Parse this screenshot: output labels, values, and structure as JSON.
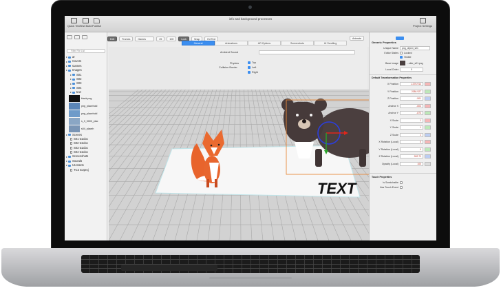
{
  "window": {
    "title": "info and background processes",
    "toolbar_left": [
      "Quick Test",
      "Test Build",
      "Publish"
    ],
    "toolbar_right": "Project Settings"
  },
  "subtoolbar": {
    "items": [
      "Edit",
      "Frames",
      "Games",
      "25",
      "100",
      "Lock",
      "Snap",
      "Ed Text"
    ],
    "right_label": "Animate"
  },
  "tabs": [
    {
      "label": "General",
      "active": true
    },
    {
      "label": "Animations",
      "active": false
    },
    {
      "label": "AR Options",
      "active": false
    },
    {
      "label": "Screenshots",
      "active": false
    },
    {
      "label": "UI Scrolling",
      "active": false
    }
  ],
  "sidebar": {
    "search_placeholder": "Filter File List",
    "tree": [
      {
        "label": "ar",
        "kind": "folder"
      },
      {
        "label": "Covers",
        "kind": "folder"
      },
      {
        "label": "Games",
        "kind": "folder"
      },
      {
        "label": "Images",
        "kind": "folder"
      },
      {
        "label": "S01",
        "kind": "folder"
      },
      {
        "label": "S02",
        "kind": "folder"
      },
      {
        "label": "S03",
        "kind": "folder"
      },
      {
        "label": "S04",
        "kind": "folder"
      },
      {
        "label": "text",
        "kind": "folder"
      }
    ],
    "thumbnails": [
      {
        "label": "black.png",
        "color": "#111111"
      },
      {
        "label": "png_placehold",
        "color": "#5b86b8"
      },
      {
        "label": "png_placehold",
        "color": "#6f9bc9"
      },
      {
        "label": "s_3_0000_plac",
        "color": "#8aa6c4"
      },
      {
        "label": "s04_placeh",
        "color": "#7a95b5"
      }
    ],
    "tree2": [
      {
        "label": "Scenes",
        "kind": "folder"
      },
      {
        "label": "S01 tc2doc",
        "kind": "doc"
      },
      {
        "label": "S02 tc2doc",
        "kind": "doc"
      },
      {
        "label": "S03 tc2doc",
        "kind": "doc"
      },
      {
        "label": "S04 tc2doc",
        "kind": "doc"
      },
      {
        "label": "Screenshots",
        "kind": "folder"
      },
      {
        "label": "Sounds",
        "kind": "folder"
      },
      {
        "label": "UIAssets",
        "kind": "folder"
      },
      {
        "label": "TC2 tc2proj",
        "kind": "doc"
      }
    ]
  },
  "scene_props": {
    "ambient_label": "Ambient Sound",
    "physics_label": "Physics",
    "collision_label": "Collision Border",
    "checks": [
      {
        "label": "Top",
        "checked": true
      },
      {
        "label": "Left",
        "checked": true
      },
      {
        "label": "Right",
        "checked": true
      }
    ]
  },
  "scene": {
    "text_object": "TEXT"
  },
  "inspector": {
    "generic_title": "Generic Properties",
    "unique_name_label": "Unique Name",
    "unique_name_value": "png_object_s01",
    "editor_states_label": "Editor States",
    "locked_label": "Locked",
    "visible_label": "Visible",
    "base_image_label": "Base image",
    "base_image_value": "...otter_s01.png",
    "local_order_label": "Local Order",
    "local_order_value": "0",
    "transform_title": "Default Transformation Properties",
    "rows": [
      {
        "label": "X Position",
        "value": "-1376.914",
        "swatch": "#f6b6b6"
      },
      {
        "label": "Y Position",
        "value": "2084.927",
        "swatch": "#bde8b8"
      },
      {
        "label": "Z Position",
        "value": "-501",
        "swatch": "#bccdf2"
      },
      {
        "label": "Anchor X",
        "value": "-604",
        "swatch": "#f6b6b6"
      },
      {
        "label": "Anchor Y",
        "value": "-873",
        "swatch": "#bde8b8"
      },
      {
        "label": "X Scale",
        "value": "1",
        "swatch": "#f6b6b6"
      },
      {
        "label": "Y Scale",
        "value": "1",
        "swatch": "#bde8b8"
      },
      {
        "label": "Z Scale",
        "value": "1",
        "swatch": "#bccdf2"
      },
      {
        "label": "X Rotation (Local)",
        "value": "0",
        "swatch": "#f6b6b6"
      },
      {
        "label": "Y Rotation (Local)",
        "value": "0",
        "swatch": "#bde8b8"
      },
      {
        "label": "Z Rotation (Local)",
        "value": "262.72",
        "swatch": "#bccdf2"
      },
      {
        "label": "Opacity (Local)",
        "value": "100",
        "swatch": "#dddddd"
      }
    ],
    "touch_title": "Touch Properties",
    "touch_rows": [
      "Is Scratchable",
      "Has Touch Event"
    ]
  },
  "colors": {
    "accent": "#3b8ef0",
    "selection": "#e8893a",
    "gizmo": "#2b3ee0"
  }
}
